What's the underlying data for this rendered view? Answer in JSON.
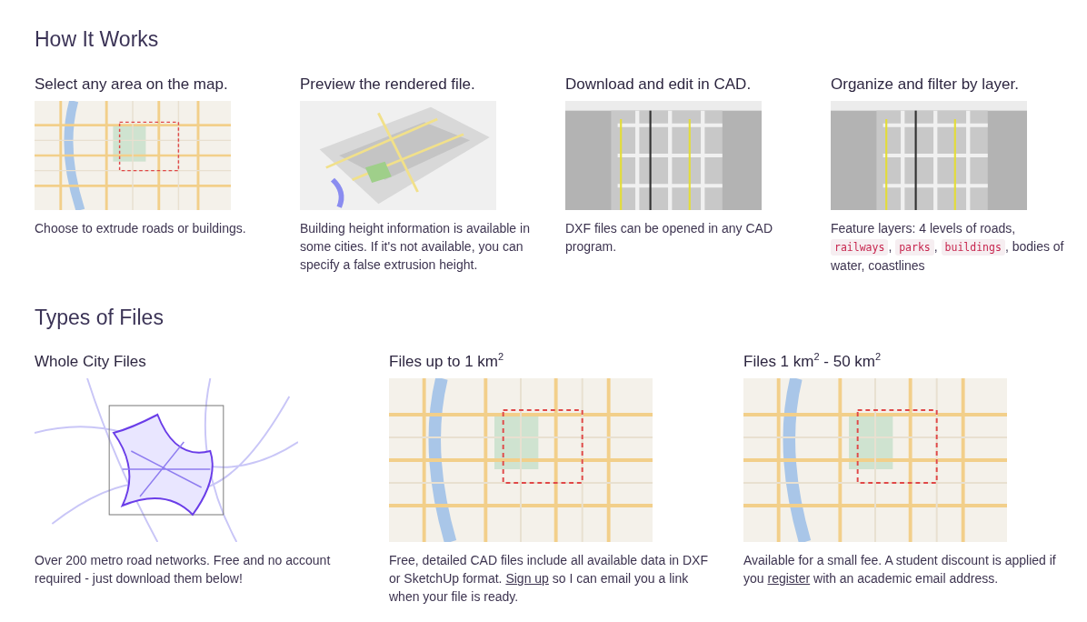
{
  "sections": [
    {
      "title": "How It Works",
      "columns": [
        {
          "heading": "Select any area on the map.",
          "picture": {
            "kind": "picture"
          },
          "description": [
            {
              "kind": "text",
              "text": "Choose to extrude roads or buildings."
            }
          ]
        },
        {
          "heading": "Preview the rendered file.",
          "picture": {
            "kind": "picture"
          },
          "description": [
            {
              "kind": "text",
              "text": "Building height information is available in some cities. If it's not available, you can specify a false extrusion height."
            }
          ]
        },
        {
          "heading": "Download and edit in CAD.",
          "picture": {
            "kind": "picture"
          },
          "description": [
            {
              "kind": "text",
              "text": "DXF files can be opened in any CAD program."
            }
          ]
        },
        {
          "heading": "Organize and filter by layer.",
          "picture": {
            "kind": "picture"
          },
          "description": [
            {
              "kind": "text",
              "text": "Feature layers: 4 levels of roads, "
            },
            {
              "kind": "code",
              "text": "railways"
            },
            {
              "kind": "text",
              "text": ", "
            },
            {
              "kind": "code",
              "text": "parks"
            },
            {
              "kind": "text",
              "text": ", "
            },
            {
              "kind": "code",
              "text": "buildings"
            },
            {
              "kind": "text",
              "text": ", bodies of water, coastlines"
            }
          ]
        }
      ]
    },
    {
      "title": "Types of Files",
      "columns": [
        {
          "heading": "Whole City Files",
          "picture": {
            "kind": "picture"
          },
          "description": [
            {
              "kind": "text",
              "text": "Over 200 metro road networks. Free and no account required - just download them below!"
            }
          ]
        },
        {
          "heading": "Files up to 1 km$^{2}$",
          "picture": {
            "kind": "picture"
          },
          "description": [
            {
              "kind": "text",
              "text": "Free, detailed CAD files include all available data in DXF or SketchUp format. "
            },
            {
              "kind": "link",
              "text": "Sign up"
            },
            {
              "kind": "text",
              "text": " so I can email you a link when your file is ready."
            }
          ]
        },
        {
          "heading": "Files 1 km$^{2}$ - 50 km$^{2}$",
          "picture": {
            "kind": "picture"
          },
          "description": [
            {
              "kind": "text",
              "text": "Available for a small fee. A student discount is applied if you "
            },
            {
              "kind": "link",
              "text": "register"
            },
            {
              "kind": "text",
              "text": " with an academic email address."
            }
          ]
        }
      ]
    }
  ]
}
